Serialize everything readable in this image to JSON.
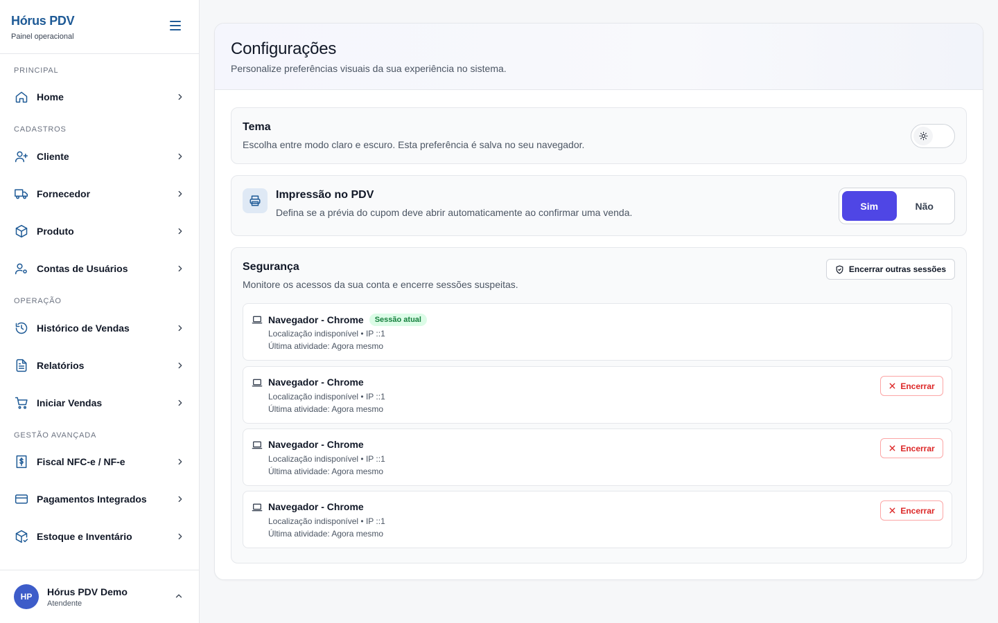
{
  "brand": {
    "name": "Hórus PDV",
    "subtitle": "Painel operacional"
  },
  "sidebar": {
    "sections": {
      "principal": "PRINCIPAL",
      "cadastros": "CADASTROS",
      "operacao": "OPERAÇÃO",
      "gestao": "GESTÃO AVANÇADA"
    },
    "items": {
      "home": "Home",
      "cliente": "Cliente",
      "fornecedor": "Fornecedor",
      "produto": "Produto",
      "contas": "Contas de Usuários",
      "historico": "Histórico de Vendas",
      "relatorios": "Relatórios",
      "iniciar": "Iniciar Vendas",
      "fiscal": "Fiscal NFC-e / NF-e",
      "pagamentos": "Pagamentos Integrados",
      "estoque": "Estoque e Inventário"
    }
  },
  "user": {
    "initials": "HP",
    "name": "Hórus PDV Demo",
    "role": "Atendente"
  },
  "page": {
    "title": "Configurações",
    "subtitle": "Personalize preferências visuais da sua experiência no sistema."
  },
  "theme": {
    "title": "Tema",
    "description": "Escolha entre modo claro e escuro. Esta preferência é salva no seu navegador."
  },
  "printing": {
    "title": "Impressão no PDV",
    "description": "Defina se a prévia do cupom deve abrir automaticamente ao confirmar uma venda.",
    "yes": "Sim",
    "no": "Não",
    "selected": "Sim"
  },
  "security": {
    "title": "Segurança",
    "description": "Monitore os acessos da sua conta e encerre sessões suspeitas.",
    "end_others": "Encerrar outras sessões",
    "current_badge": "Sessão atual",
    "end_label": "Encerrar",
    "sessions": [
      {
        "name": "Navegador - Chrome",
        "location": "Localização indisponível • IP ::1",
        "activity": "Última atividade: Agora mesmo"
      },
      {
        "name": "Navegador - Chrome",
        "location": "Localização indisponível • IP ::1",
        "activity": "Última atividade: Agora mesmo"
      },
      {
        "name": "Navegador - Chrome",
        "location": "Localização indisponível • IP ::1",
        "activity": "Última atividade: Agora mesmo"
      },
      {
        "name": "Navegador - Chrome",
        "location": "Localização indisponível • IP ::1",
        "activity": "Última atividade: Agora mesmo"
      }
    ]
  },
  "colors": {
    "brand": "#1e5a96",
    "accent": "#4f46e5",
    "danger": "#dc2626",
    "success": "#15803d"
  }
}
